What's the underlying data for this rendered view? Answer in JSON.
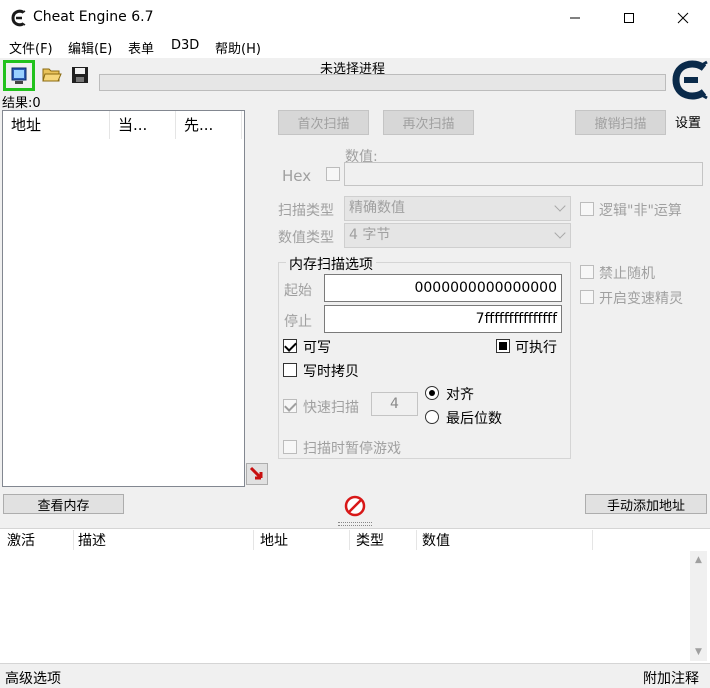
{
  "window": {
    "title": "Cheat Engine 6.7",
    "icons": {
      "app": "cheat-engine-icon",
      "minimize": "minimize-icon",
      "maximize": "maximize-icon",
      "close": "close-icon"
    }
  },
  "menu": [
    "文件(F)",
    "编辑(E)",
    "表单",
    "D3D",
    "帮助(H)"
  ],
  "toolbar": {
    "icons": [
      "open-process-icon",
      "open-file-icon",
      "save-icon"
    ],
    "highlight_color": "#22c21d"
  },
  "process": {
    "title": "未选择进程"
  },
  "settings": {
    "label": "设置"
  },
  "results": {
    "label": "结果:0",
    "columns": [
      "地址",
      "当...",
      "先..."
    ]
  },
  "scan_buttons": {
    "first": "首次扫描",
    "next": "再次扫描",
    "undo": "撤销扫描"
  },
  "value": {
    "label": "数值:",
    "hex_label": "Hex",
    "current": ""
  },
  "scan_type": {
    "label": "扫描类型",
    "selected": "精确数值"
  },
  "value_type": {
    "label": "数值类型",
    "selected": "4 字节"
  },
  "options": {
    "logic_not": "逻辑\"非\"运算",
    "no_random": "禁止随机",
    "speedhack": "开启变速精灵"
  },
  "memory_scan": {
    "title": "内存扫描选项",
    "start_label": "起始",
    "start_value": "0000000000000000",
    "stop_label": "停止",
    "stop_value": "7fffffffffffffff",
    "writable": "可写",
    "executable": "可执行",
    "copy_on_write": "写时拷贝",
    "fast_scan": "快速扫描",
    "fast_scan_value": "4",
    "align": "对齐",
    "last_digits": "最后位数",
    "pause_game": "扫描时暂停游戏"
  },
  "bottom_buttons": {
    "view_memory": "查看内存",
    "add_address": "手动添加地址"
  },
  "address_table": {
    "columns": [
      "激活",
      "描述",
      "地址",
      "类型",
      "数值"
    ]
  },
  "status": {
    "advanced": "高级选项",
    "comments": "附加注释"
  }
}
